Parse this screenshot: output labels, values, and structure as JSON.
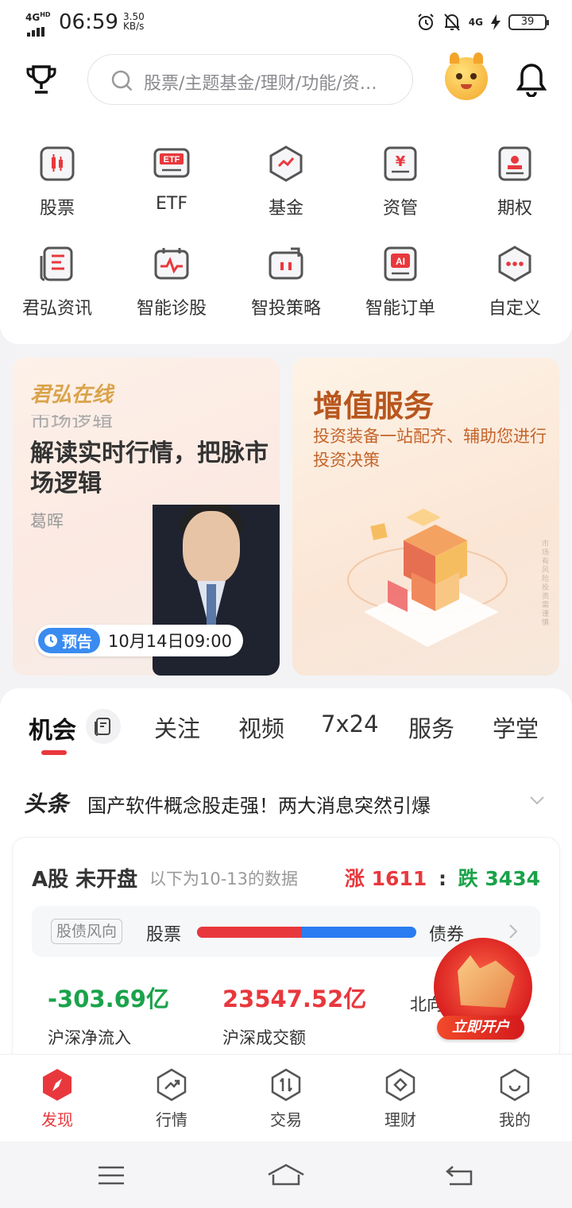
{
  "status": {
    "network": "4G",
    "network_sup": "HD",
    "time": "06:59",
    "speed_value": "3.50",
    "speed_unit": "KB/s",
    "network2": "4G",
    "battery": "39",
    "icons": [
      "alarm-icon",
      "mute-bell-icon",
      "signal-4g-icon",
      "charging-icon",
      "battery-icon"
    ]
  },
  "header": {
    "search_placeholder": "股票/主题基金/理财/功能/资…",
    "icons": [
      "trophy-icon",
      "search-icon",
      "mascot-avatar",
      "bell-icon"
    ]
  },
  "grid": [
    {
      "label": "股票",
      "icon": "candlestick-icon"
    },
    {
      "label": "ETF",
      "icon": "etf-icon"
    },
    {
      "label": "基金",
      "icon": "fund-icon"
    },
    {
      "label": "资管",
      "icon": "yuan-icon"
    },
    {
      "label": "期权",
      "icon": "option-icon"
    },
    {
      "label": "君弘资讯",
      "icon": "news-icon"
    },
    {
      "label": "智能诊股",
      "icon": "diagnose-icon"
    },
    {
      "label": "智投策略",
      "icon": "strategy-icon"
    },
    {
      "label": "智能订单",
      "icon": "ai-order-icon"
    },
    {
      "label": "自定义",
      "icon": "custom-icon"
    }
  ],
  "banner_live": {
    "brand": "君弘在线",
    "ghost_text": "市场逻辑",
    "title": "解读实时行情，把脉市场逻辑",
    "speaker": "葛晖",
    "tag": "预告",
    "time": "10月14日09:00"
  },
  "banner_service": {
    "title": "增值服务",
    "subtitle": "投资装备一站配齐、辅助您进行投资决策",
    "vertical_note": "市场有风险 投资需谨慎"
  },
  "tabs": [
    {
      "label": "机会",
      "active": true
    },
    {
      "label": "关注",
      "active": false
    },
    {
      "label": "视频",
      "active": false
    },
    {
      "label": "7x24",
      "active": false
    },
    {
      "label": "服务",
      "active": false
    },
    {
      "label": "学堂",
      "active": false
    }
  ],
  "headline": {
    "tag": "头条",
    "text": "国产软件概念股走强！两大消息突然引爆"
  },
  "market": {
    "title": "A股 未开盘",
    "subtitle": "以下为10-13的数据",
    "up_label": "涨",
    "up_count": "1611",
    "separator": ":",
    "down_label": "跌",
    "down_count": "3434",
    "sentiment_badge": "股债风向",
    "left_label": "股票",
    "right_label": "债券",
    "stock_share": 0.48,
    "colors": {
      "up": "#e8383d",
      "down": "#1aa34a",
      "bond": "#2a7cf0"
    },
    "stats": [
      {
        "value": "-303.69亿",
        "label": "沪深净流入",
        "color": "down"
      },
      {
        "value": "23547.52亿",
        "label": "沪深成交额",
        "color": "up"
      },
      {
        "value": "",
        "label": "北向资金流入",
        "color": "down"
      }
    ]
  },
  "promo": {
    "label": "立即开户"
  },
  "bottom_nav": [
    {
      "label": "发现",
      "icon": "compass-icon",
      "active": true
    },
    {
      "label": "行情",
      "icon": "trend-icon",
      "active": false
    },
    {
      "label": "交易",
      "icon": "trade-icon",
      "active": false
    },
    {
      "label": "理财",
      "icon": "wealth-icon",
      "active": false
    },
    {
      "label": "我的",
      "icon": "profile-icon",
      "active": false
    }
  ],
  "system_nav": [
    "menu-icon",
    "home-icon",
    "back-icon"
  ]
}
